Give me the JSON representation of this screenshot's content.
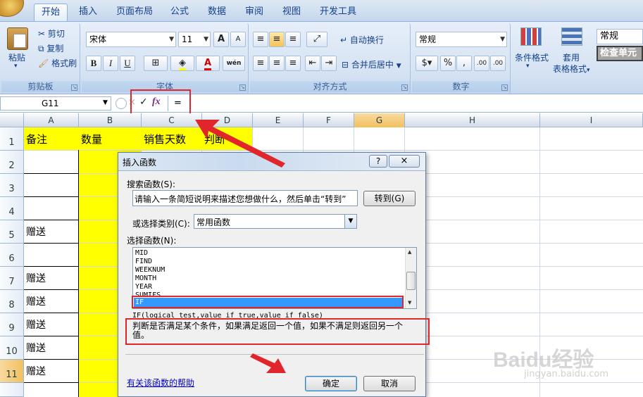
{
  "ribbon": {
    "tabs": [
      "开始",
      "插入",
      "页面布局",
      "公式",
      "数据",
      "审阅",
      "视图",
      "开发工具"
    ],
    "clipboard": {
      "paste": "粘贴",
      "cut": "剪切",
      "copy": "复制",
      "format_painter": "格式刷",
      "label": "剪贴板"
    },
    "font": {
      "name": "宋体",
      "size": "11",
      "label": "字体",
      "bold": "B",
      "italic": "I",
      "underline": "U",
      "grow": "A",
      "shrink": "A",
      "phonetic": "wén"
    },
    "alignment": {
      "wrap": "自动换行",
      "merge": "合并后居中",
      "label": "对齐方式"
    },
    "number": {
      "format": "常规",
      "percent": "%",
      "comma": ",",
      "label": "数字",
      "inc_decimal": ".00",
      "dec_decimal": ".00"
    },
    "styles": {
      "conditional": "条件格式",
      "table_format_1": "套用",
      "table_format_2": "表格格式",
      "cell_style_1": "常规",
      "cell_style_2": "检查单元"
    }
  },
  "formula_bar": {
    "name_box": "G11",
    "cancel": "×",
    "enter": "✓",
    "fx": "fx",
    "content": "="
  },
  "columns": [
    "A",
    "B",
    "C",
    "D",
    "E",
    "F",
    "G",
    "H",
    "I"
  ],
  "rows": [
    "1",
    "2",
    "3",
    "4",
    "5",
    "6",
    "7",
    "8",
    "9",
    "10",
    "11"
  ],
  "cells": {
    "A1": "备注",
    "B1": "数量",
    "C1": "销售天数",
    "D1": "判断",
    "A5": "赠送",
    "A7": "赠送",
    "A8": "赠送",
    "A9": "赠送",
    "A10": "赠送",
    "A11": "赠送"
  },
  "dialog": {
    "title": "插入函数",
    "help_btn": "?",
    "close_btn": "×",
    "search_label": "搜索函数(S):",
    "search_value": "请输入一条简短说明来描述您想做什么，然后单击“转到”",
    "go_button": "转到(G)",
    "category_label": "或选择类别(C):",
    "category_value": "常用函数",
    "select_label": "选择函数(N):",
    "functions": [
      "MID",
      "FIND",
      "WEEKNUM",
      "MONTH",
      "YEAR",
      "SUMIFS",
      "IF"
    ],
    "selected_function": "IF",
    "syntax": "IF(logical_test,value_if_true,value_if_false)",
    "description": "判断是否满足某个条件，如果满足返回一个值，如果不满足则返回另一个值。",
    "help_link": "有关该函数的帮助",
    "ok_button": "确定",
    "cancel_button": "取消"
  },
  "watermark": {
    "brand": "Baidu经验",
    "url": "jingyan.baidu.com"
  }
}
